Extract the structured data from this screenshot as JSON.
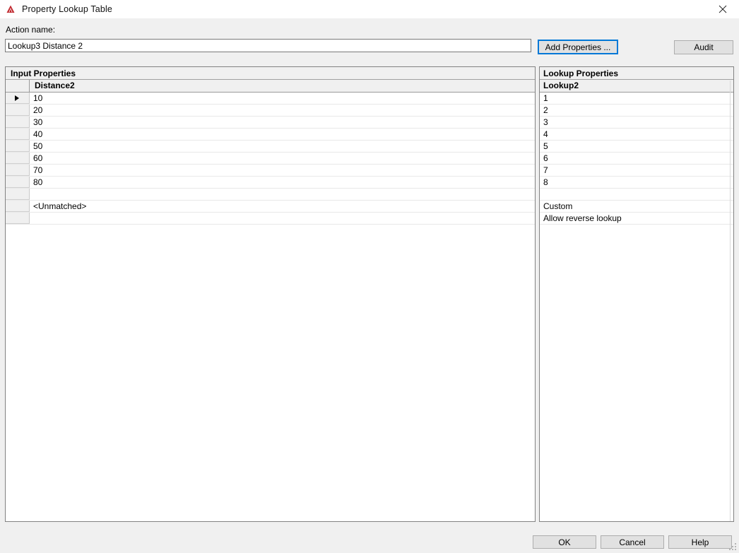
{
  "window": {
    "title": "Property Lookup Table",
    "icon": "autocad-triangle-icon",
    "close_icon": "close-icon"
  },
  "action": {
    "label": "Action name:",
    "value": "Lookup3 Distance 2",
    "placeholder": ""
  },
  "toolbar": {
    "add_properties_label": "Add Properties ...",
    "audit_label": "Audit"
  },
  "input_panel": {
    "title": "Input Properties",
    "column_header": "Distance2",
    "rows": [
      {
        "value": "10",
        "selected": true
      },
      {
        "value": "20",
        "selected": false
      },
      {
        "value": "30",
        "selected": false
      },
      {
        "value": "40",
        "selected": false
      },
      {
        "value": "50",
        "selected": false
      },
      {
        "value": "60",
        "selected": false
      },
      {
        "value": "70",
        "selected": false
      },
      {
        "value": "80",
        "selected": false
      },
      {
        "value": "",
        "selected": false
      },
      {
        "value": "<Unmatched>",
        "selected": false
      },
      {
        "value": "",
        "selected": false
      }
    ]
  },
  "lookup_panel": {
    "title": "Lookup Properties",
    "column_header": "Lookup2",
    "rows": [
      {
        "value": "1"
      },
      {
        "value": "2"
      },
      {
        "value": "3"
      },
      {
        "value": "4"
      },
      {
        "value": "5"
      },
      {
        "value": "6"
      },
      {
        "value": "7"
      },
      {
        "value": "8"
      },
      {
        "value": ""
      },
      {
        "value": "Custom"
      },
      {
        "value": "Allow reverse lookup"
      }
    ]
  },
  "footer": {
    "ok_label": "OK",
    "cancel_label": "Cancel",
    "help_label": "Help"
  },
  "colors": {
    "dialog_background": "#f0f0f0",
    "titlebar_background": "#ffffff",
    "panel_border": "#828282",
    "focus_accent": "#0078d7",
    "icon_red": "#c0272d",
    "grid_line": "#e8e8e8"
  }
}
